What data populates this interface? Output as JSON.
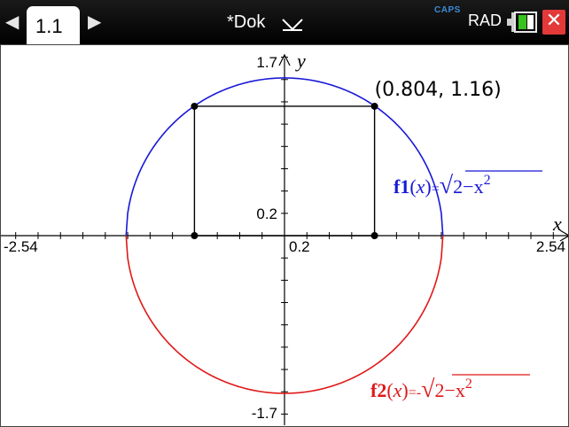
{
  "topbar": {
    "tab_label": "1.1",
    "document_title": "*Dok",
    "caps_label": "CAPS",
    "angle_mode": "RAD",
    "prev_icon": "triangle-left-icon",
    "next_icon": "triangle-right-icon",
    "close_label": "✕"
  },
  "graph": {
    "window": {
      "xmin": -2.54,
      "xmax": 2.54,
      "ymin": -1.7,
      "ymax": 1.7
    },
    "axis_labels": {
      "x": "x",
      "y": "y"
    },
    "tick_labels": {
      "xmin": "-2.54",
      "xmax": "2.54",
      "ymax": "1.7",
      "ymin": "-1.7",
      "x_scale": "0.2",
      "y_scale": "0.2"
    },
    "point": {
      "x": 0.804,
      "y": 1.16,
      "label": "(0.804, 1.16)"
    },
    "functions": [
      {
        "id": "f1",
        "name": "f1",
        "var": "x",
        "sign": "=",
        "expr": "2−x",
        "exp": "2",
        "color": "#1818d8"
      },
      {
        "id": "f2",
        "name": "f2",
        "var": "x",
        "sign": "=-",
        "expr": "2−x",
        "exp": "2",
        "color": "#e01818"
      }
    ],
    "rectangle": {
      "x1": -0.804,
      "x2": 0.804,
      "y1": 0,
      "y2": 1.16
    }
  }
}
